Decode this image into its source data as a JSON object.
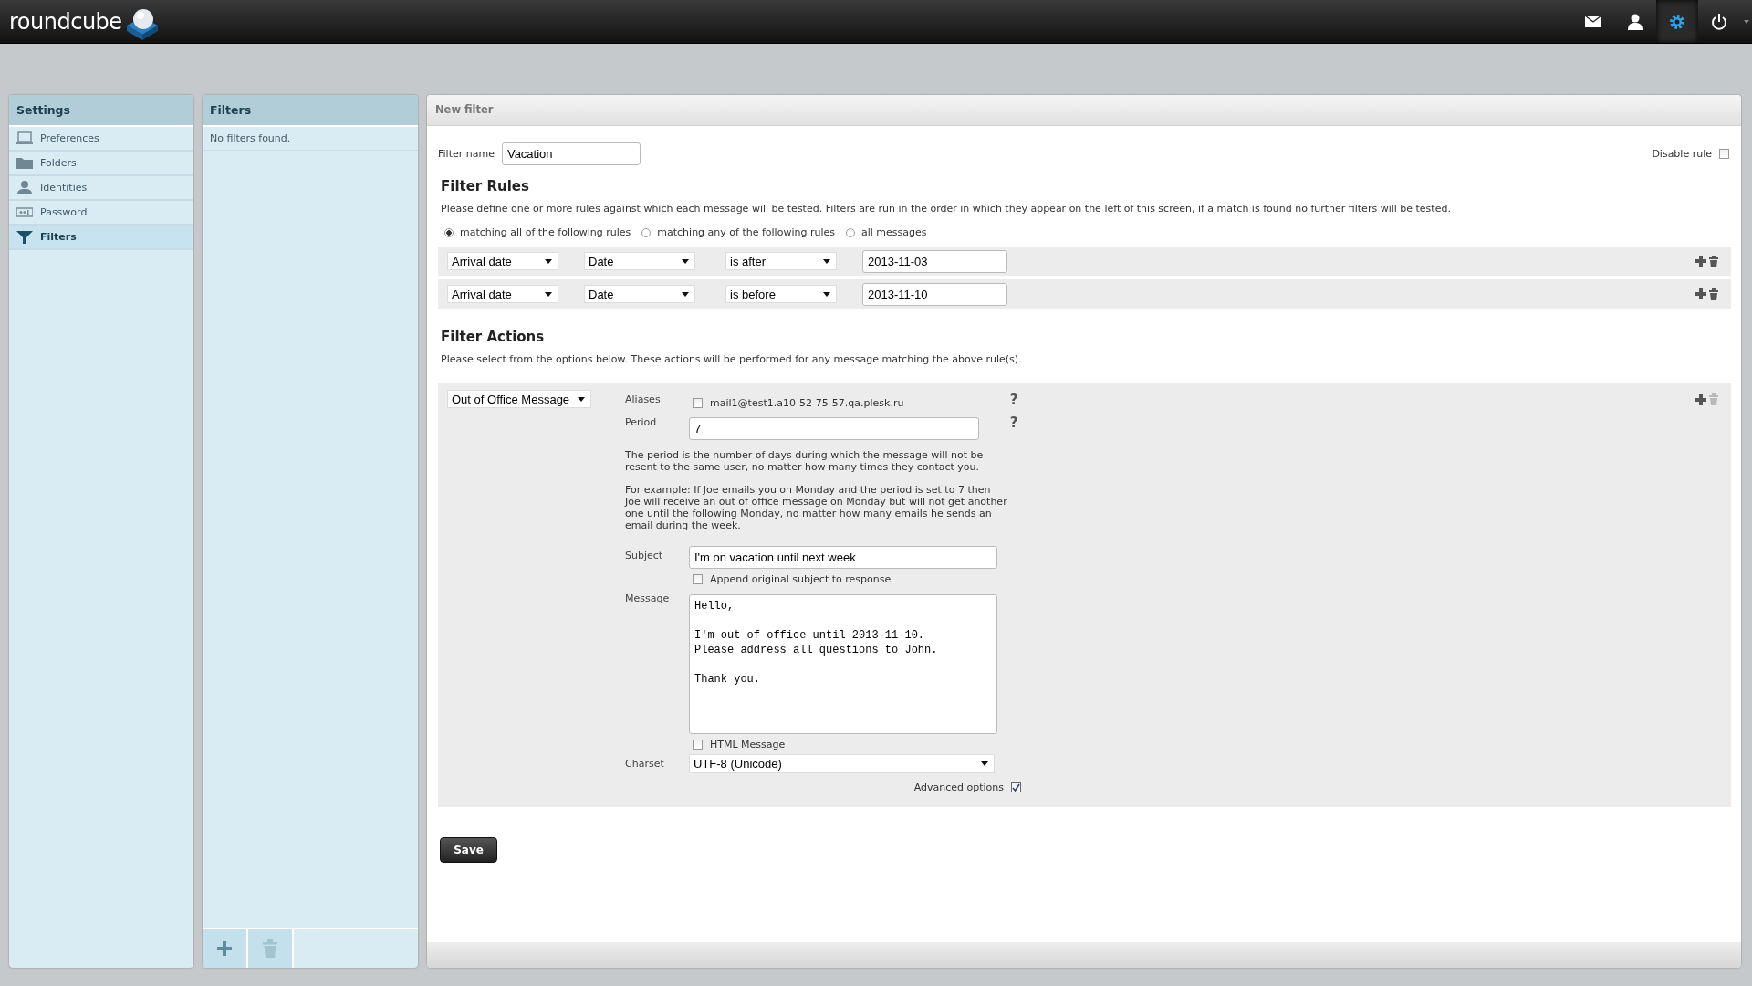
{
  "header": {
    "logo": "roundcube",
    "nav": [
      {
        "kind": "mail",
        "selected": false
      },
      {
        "kind": "contacts",
        "selected": false
      },
      {
        "kind": "settings",
        "selected": true
      },
      {
        "kind": "logout",
        "selected": false
      }
    ]
  },
  "settings": {
    "title": "Settings",
    "items": [
      {
        "label": "Preferences",
        "kind": "laptop",
        "selected": false
      },
      {
        "label": "Folders",
        "kind": "folder",
        "selected": false
      },
      {
        "label": "Identities",
        "kind": "person",
        "selected": false
      },
      {
        "label": "Password",
        "kind": "password",
        "selected": false
      },
      {
        "label": "Filters",
        "kind": "funnel",
        "selected": true
      }
    ]
  },
  "filters": {
    "title": "Filters",
    "empty_text": "No filters found.",
    "buttons": [
      {
        "kind": "add",
        "disabled": false
      },
      {
        "kind": "delete",
        "disabled": true
      }
    ]
  },
  "form": {
    "title": "New filter",
    "filter_name": {
      "label": "Filter name",
      "value": "Vacation"
    },
    "disable_rule": {
      "label": "Disable rule",
      "checked": false
    },
    "rules": {
      "heading": "Filter Rules",
      "description": "Please define one or more rules against which each message will be tested. Filters are run in the order in which they appear on the left of this screen, if a match is found no further filters will be tested.",
      "match_options": [
        {
          "label": "matching all of the following rules",
          "selected": true
        },
        {
          "label": "matching any of the following rules",
          "selected": false
        },
        {
          "label": "all messages",
          "selected": false
        }
      ],
      "rows": [
        {
          "header": "Arrival date",
          "part": "Date",
          "operator": "is after",
          "value": "2013-11-03",
          "delete_disabled": false
        },
        {
          "header": "Arrival date",
          "part": "Date",
          "operator": "is before",
          "value": "2013-11-10",
          "delete_disabled": false
        }
      ]
    },
    "actions": {
      "heading": "Filter Actions",
      "description": "Please select from the options below. These actions will be performed for any message matching the above rule(s).",
      "rows": [
        {
          "action": "Out of Office Message",
          "delete_disabled": true,
          "aliases": {
            "label": "Aliases",
            "help": "?",
            "options": [
              {
                "label": "mail1@test1.a10-52-75-57.qa.plesk.ru",
                "checked": false
              }
            ]
          },
          "period": {
            "label": "Period",
            "value": "7",
            "help": "?"
          },
          "period_hint": [
            "The period is the number of days during which the message will not be resent to the same user, no matter how many times they contact you.",
            "For example: If Joe emails you on Monday and the period is set to 7 then Joe will receive an out of office message on Monday but will not get another one until the following Monday, no matter how many emails he sends an email during the week."
          ],
          "subject": {
            "label": "Subject",
            "value": "I'm on vacation until next week"
          },
          "append_subject": {
            "label": "Append original subject to response",
            "checked": false
          },
          "message": {
            "label": "Message",
            "value": "Hello,\n\nI'm out of office until 2013-11-10.\nPlease address all questions to John.\n\nThank you."
          },
          "html_message": {
            "label": "HTML Message",
            "checked": false
          },
          "charset": {
            "label": "Charset",
            "value": "UTF-8 (Unicode)"
          },
          "advanced_options": {
            "label": "Advanced options",
            "checked": true
          }
        }
      ]
    },
    "save": "Save"
  }
}
